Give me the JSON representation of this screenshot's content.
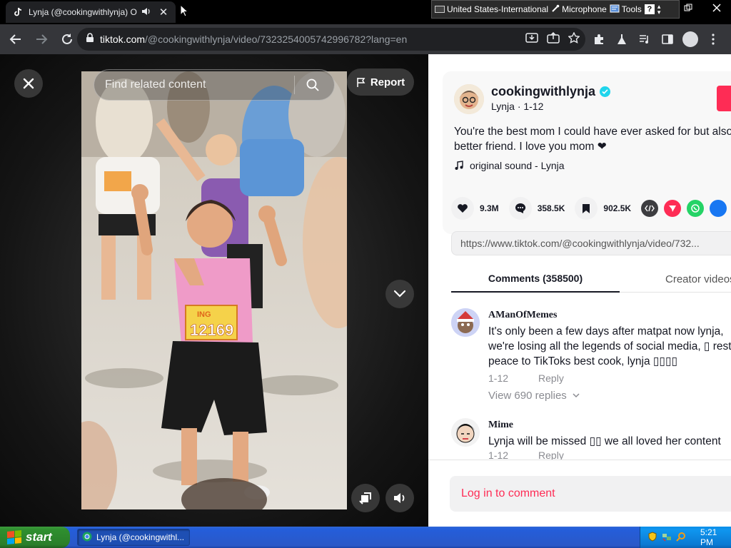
{
  "browser": {
    "tab_title": "Lynja (@cookingwithlynja) Offi",
    "tab_close": "✕",
    "url_host": "tiktok.com",
    "url_path": "/@cookingwithlynja/video/7323254005742996782?lang=en"
  },
  "language_bar": {
    "language": "United States-International",
    "microphone": "Microphone",
    "tools": "Tools",
    "help": "?"
  },
  "video": {
    "search_placeholder": "Find related content",
    "report_label": "Report",
    "bib_sponsor": "ING",
    "bib_number": "12169"
  },
  "post": {
    "author": "cookingwithlynja",
    "author_sub": "Lynja · 1-12",
    "caption": "You're the best mom I could have ever asked for but also a better friend. I love you mom ❤",
    "music": "original sound - Lynja",
    "likes": "9.3M",
    "comments_count": "358.5K",
    "saves": "902.5K",
    "link": "https://www.tiktok.com/@cookingwithlynja/video/732..."
  },
  "tabs": {
    "comments": "Comments (358500)",
    "creator": "Creator videos"
  },
  "comments": [
    {
      "user": "AManOfMemes",
      "text": "It's only been a few days after matpat now lynja, we're losing all the legends of social media, ▯ rest in peace to TikToks best cook, lynja ▯▯▯▯",
      "date": "1-12",
      "reply": "Reply",
      "replies": "View 690 replies"
    },
    {
      "user": "Mime",
      "text": "Lynja will be missed ▯▯ we all loved her content",
      "date": "1-12",
      "reply": "Reply",
      "replies": ""
    }
  ],
  "login_label": "Log in to comment",
  "taskbar": {
    "start": "start",
    "task_label": "Lynja (@cookingwithl...",
    "time": "5:21 PM"
  },
  "colors": {
    "accent": "#fe2c55",
    "verified": "#20d5ec",
    "taskbar": "#245edb"
  }
}
